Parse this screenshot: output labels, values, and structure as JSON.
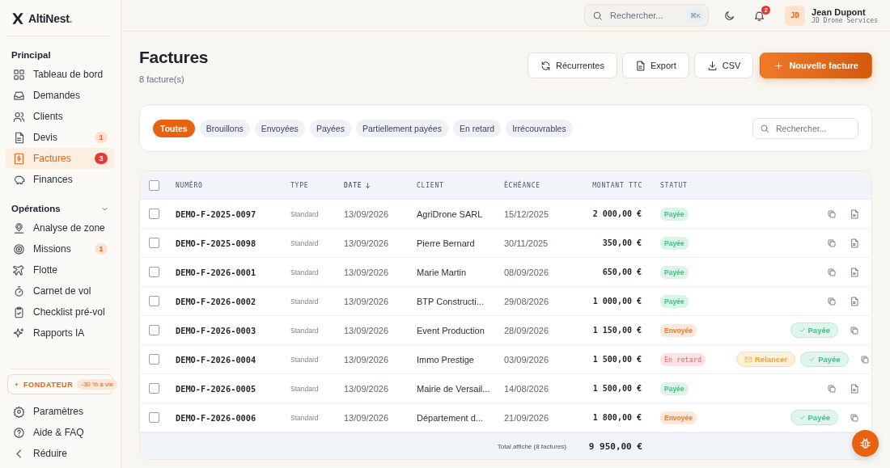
{
  "sidebar": {
    "brand": {
      "name": "AltiNest",
      "dot": "."
    },
    "sections": [
      {
        "title": "Principal",
        "items": [
          {
            "label": "Tableau de bord",
            "selected": false
          },
          {
            "label": "Demandes",
            "selected": false
          },
          {
            "label": "Clients",
            "selected": false
          },
          {
            "label": "Devis",
            "badge": {
              "label": "1",
              "kind": "soft"
            },
            "selected": false
          },
          {
            "label": "Factures",
            "badge": {
              "label": "3",
              "kind": "alert"
            },
            "selected": true
          },
          {
            "label": "Finances",
            "selected": false
          }
        ]
      },
      {
        "title": "Opérations",
        "expanded": true,
        "items": [
          {
            "label": "Analyse de zone",
            "selected": false
          },
          {
            "label": "Missions",
            "badge": {
              "label": "1",
              "kind": "soft"
            },
            "selected": false
          },
          {
            "label": "Flotte",
            "selected": false
          },
          {
            "label": "Carnet de vol",
            "selected": false
          },
          {
            "label": "Checklist pré-vol",
            "selected": false
          },
          {
            "label": "Rapports IA",
            "selected": false
          }
        ]
      }
    ],
    "founder": {
      "label": "FONDATEUR",
      "offer": "-30 % à vie"
    },
    "footer_items": [
      {
        "label": "Paramètres"
      },
      {
        "label": "Aide & FAQ"
      },
      {
        "label": "Réduire"
      }
    ]
  },
  "topbar": {
    "search": {
      "placeholder": "Rechercher...",
      "shortcut": "⌘K"
    },
    "notifications": "2",
    "user": {
      "initials": "JD",
      "name": "Jean Dupont",
      "company": "JD Drone Services"
    }
  },
  "header": {
    "title": "Factures",
    "subtitle": "8 facture(s)",
    "buttons": [
      {
        "label": "Récurrentes",
        "kind": "secondary"
      },
      {
        "label": "Export",
        "kind": "secondary"
      },
      {
        "label": "CSV",
        "kind": "secondary"
      },
      {
        "label": "Nouvelle facture",
        "kind": "primary"
      }
    ]
  },
  "filters": {
    "chips": [
      {
        "label": "Toutes",
        "selected": true
      },
      {
        "label": "Brouillons",
        "selected": false
      },
      {
        "label": "Envoyées",
        "selected": false
      },
      {
        "label": "Payées",
        "selected": false
      },
      {
        "label": "Partiellement payées",
        "selected": false
      },
      {
        "label": "En retard",
        "selected": false
      },
      {
        "label": "Irrécouvrables",
        "selected": false
      }
    ],
    "search": {
      "placeholder": "Rechercher..."
    }
  },
  "table": {
    "select_all_checked": false,
    "columns": [
      {
        "label": "NUMÉRO",
        "sorted": false
      },
      {
        "label": "TYPE",
        "sorted": false
      },
      {
        "label": "DATE",
        "sorted": true
      },
      {
        "label": "CLIENT",
        "sorted": false
      },
      {
        "label": "ÉCHÉANCE",
        "sorted": false
      },
      {
        "label": "MONTANT TTC",
        "sorted": false
      },
      {
        "label": "STATUT",
        "sorted": false
      }
    ],
    "rows": [
      {
        "checked": false,
        "number": "DEMO-F-2025-0097",
        "type": "Standard",
        "date": "13/09/2026",
        "client": "AgriDrone SARL",
        "due": "15/12/2025",
        "amount": "2 000,00 €",
        "status": {
          "label": "Payée",
          "kind": "paid"
        },
        "actions": [
          {
            "kind": "copy"
          },
          {
            "kind": "pdf"
          }
        ]
      },
      {
        "checked": false,
        "number": "DEMO-F-2025-0098",
        "type": "Standard",
        "date": "13/09/2026",
        "client": "Pierre Bernard",
        "due": "30/11/2025",
        "amount": "350,00 €",
        "status": {
          "label": "Payée",
          "kind": "paid"
        },
        "actions": [
          {
            "kind": "copy"
          },
          {
            "kind": "pdf"
          }
        ]
      },
      {
        "checked": false,
        "number": "DEMO-F-2026-0001",
        "type": "Standard",
        "date": "13/09/2026",
        "client": "Marie Martin",
        "due": "08/09/2026",
        "amount": "650,00 €",
        "status": {
          "label": "Payée",
          "kind": "paid"
        },
        "actions": [
          {
            "kind": "copy"
          },
          {
            "kind": "pdf"
          }
        ]
      },
      {
        "checked": false,
        "number": "DEMO-F-2026-0002",
        "type": "Standard",
        "date": "13/09/2026",
        "client": "BTP Constructi...",
        "due": "29/08/2026",
        "amount": "1 000,00 €",
        "status": {
          "label": "Payée",
          "kind": "paid"
        },
        "actions": [
          {
            "kind": "copy"
          },
          {
            "kind": "pdf"
          }
        ]
      },
      {
        "checked": false,
        "number": "DEMO-F-2026-0003",
        "type": "Standard",
        "date": "13/09/2026",
        "client": "Event Production",
        "due": "28/09/2026",
        "amount": "1 150,00 €",
        "status": {
          "label": "Envoyée",
          "kind": "sent"
        },
        "actions": [
          {
            "kind": "mark_paid",
            "label": "Payée"
          },
          {
            "kind": "copy"
          }
        ]
      },
      {
        "checked": false,
        "number": "DEMO-F-2026-0004",
        "type": "Standard",
        "date": "13/09/2026",
        "client": "Immo Prestige",
        "due": "03/09/2026",
        "amount": "1 500,00 €",
        "status": {
          "label": "En retard",
          "kind": "late"
        },
        "actions": [
          {
            "kind": "remind",
            "label": "Relancer"
          },
          {
            "kind": "mark_paid",
            "label": "Payée"
          },
          {
            "kind": "copy"
          }
        ]
      },
      {
        "checked": false,
        "number": "DEMO-F-2026-0005",
        "type": "Standard",
        "date": "13/09/2026",
        "client": "Mairie de Versail...",
        "due": "14/08/2026",
        "amount": "1 500,00 €",
        "status": {
          "label": "Payée",
          "kind": "paid"
        },
        "actions": [
          {
            "kind": "copy"
          },
          {
            "kind": "pdf"
          }
        ]
      },
      {
        "checked": false,
        "number": "DEMO-F-2026-0006",
        "type": "Standard",
        "date": "13/09/2026",
        "client": "Département d...",
        "due": "21/09/2026",
        "amount": "1 800,00 €",
        "status": {
          "label": "Envoyée",
          "kind": "sent"
        },
        "actions": [
          {
            "kind": "mark_paid",
            "label": "Payée"
          },
          {
            "kind": "copy"
          }
        ]
      }
    ],
    "footer": {
      "label": "Total affiché (8 factures)",
      "total": "9 950,00 €"
    }
  }
}
